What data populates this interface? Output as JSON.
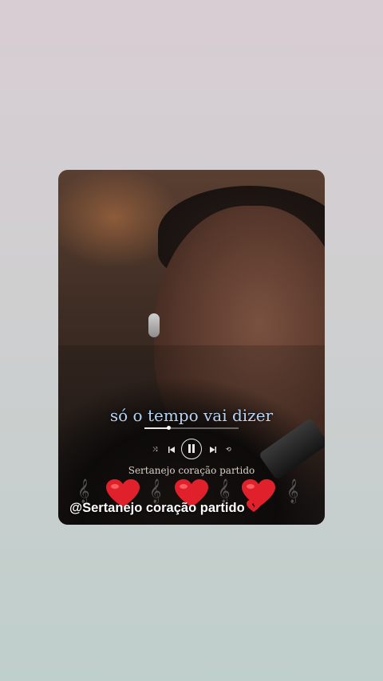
{
  "player": {
    "lyric": "só o tempo vai dizer",
    "time_elapsed": "",
    "time_total": "",
    "progress": 0.25,
    "subtitle": "Sertanejo coração partido"
  },
  "caption": {
    "text": "@Sertanejo coração partido"
  },
  "icons": [
    "earpiece",
    "shuffle-icon",
    "previous-icon",
    "pause-icon",
    "next-icon",
    "repeat-icon",
    "treble-clef-icon",
    "red-heart-icon",
    "broken-heart-icon"
  ],
  "colors": {
    "lyric": "#b8d3f0",
    "heart": "#e0202b",
    "background_top": "#d8cdd3",
    "background_bottom": "#bfcfcb"
  }
}
